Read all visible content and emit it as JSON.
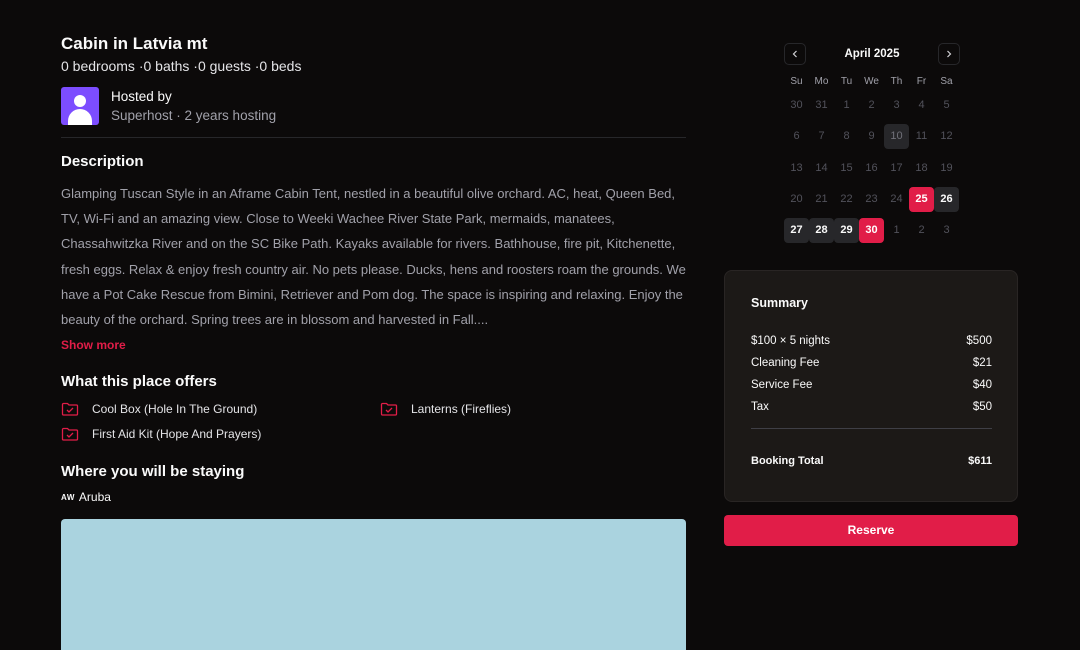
{
  "listing": {
    "title": "Cabin in Latvia mt",
    "subtitle": "0 bedrooms ·0 baths ·0 guests ·0 beds"
  },
  "host": {
    "name": "Hosted by",
    "meta": "Superhost · 2 years hosting"
  },
  "description": {
    "heading": "Description",
    "text": "Glamping Tuscan Style in an Aframe Cabin Tent, nestled in a beautiful olive orchard. AC, heat, Queen Bed, TV, Wi-Fi and an amazing view. Close to Weeki Wachee River State Park, mermaids, manatees, Chassahwitzka River and on the SC Bike Path. Kayaks available for rivers. Bathhouse, fire pit, Kitchenette, fresh eggs. Relax & enjoy fresh country air. No pets please. Ducks, hens and roosters roam the grounds. We have a Pot Cake Rescue from Bimini, Retriever and Pom dog. The space is inspiring and relaxing. Enjoy the beauty of the orchard. Spring trees are in blossom and harvested in Fall....",
    "show_more": "Show more"
  },
  "offers": {
    "heading": "What this place offers",
    "items": [
      {
        "label": "Cool Box (Hole In The Ground)",
        "icon": "folder-check-icon"
      },
      {
        "label": "Lanterns (Fireflies)",
        "icon": "folder-check-icon"
      },
      {
        "label": "First Aid Kit (Hope And Prayers)",
        "icon": "folder-check-icon"
      }
    ]
  },
  "location": {
    "heading": "Where you will be staying",
    "flag": "AW",
    "name": "Aruba"
  },
  "calendar": {
    "month": "April 2025",
    "prev_icon": "chevron-left-icon",
    "next_icon": "chevron-right-icon",
    "weekdays": [
      "Su",
      "Mo",
      "Tu",
      "We",
      "Th",
      "Fr",
      "Sa"
    ],
    "days": [
      {
        "d": "30",
        "s": "out"
      },
      {
        "d": "31",
        "s": "out"
      },
      {
        "d": "1",
        "s": "muted"
      },
      {
        "d": "2",
        "s": "muted"
      },
      {
        "d": "3",
        "s": "muted"
      },
      {
        "d": "4",
        "s": "muted"
      },
      {
        "d": "5",
        "s": "muted"
      },
      {
        "d": "6",
        "s": "muted"
      },
      {
        "d": "7",
        "s": "muted"
      },
      {
        "d": "8",
        "s": "muted"
      },
      {
        "d": "9",
        "s": "muted"
      },
      {
        "d": "10",
        "s": "today"
      },
      {
        "d": "11",
        "s": "muted"
      },
      {
        "d": "12",
        "s": "muted"
      },
      {
        "d": "13",
        "s": "muted"
      },
      {
        "d": "14",
        "s": "muted"
      },
      {
        "d": "15",
        "s": "muted"
      },
      {
        "d": "16",
        "s": "muted"
      },
      {
        "d": "17",
        "s": "muted"
      },
      {
        "d": "18",
        "s": "muted"
      },
      {
        "d": "19",
        "s": "muted"
      },
      {
        "d": "20",
        "s": "muted"
      },
      {
        "d": "21",
        "s": "muted"
      },
      {
        "d": "22",
        "s": "muted"
      },
      {
        "d": "23",
        "s": "muted"
      },
      {
        "d": "24",
        "s": "muted"
      },
      {
        "d": "25",
        "s": "sel"
      },
      {
        "d": "26",
        "s": "range"
      },
      {
        "d": "27",
        "s": "range"
      },
      {
        "d": "28",
        "s": "range"
      },
      {
        "d": "29",
        "s": "range"
      },
      {
        "d": "30",
        "s": "sel"
      },
      {
        "d": "1",
        "s": "out"
      },
      {
        "d": "2",
        "s": "out"
      },
      {
        "d": "3",
        "s": "out"
      }
    ]
  },
  "summary": {
    "heading": "Summary",
    "rows": [
      {
        "label": "$100 × 5 nights",
        "value": "$500"
      },
      {
        "label": "Cleaning Fee",
        "value": "$21"
      },
      {
        "label": "Service Fee",
        "value": "$40"
      },
      {
        "label": "Tax",
        "value": "$50"
      }
    ],
    "total_label": "Booking Total",
    "total_value": "$611"
  },
  "reserve_label": "Reserve",
  "colors": {
    "accent": "#e11d48",
    "background": "#0c0a0a",
    "map": "#aad3df",
    "avatar": "#7c4dff"
  }
}
